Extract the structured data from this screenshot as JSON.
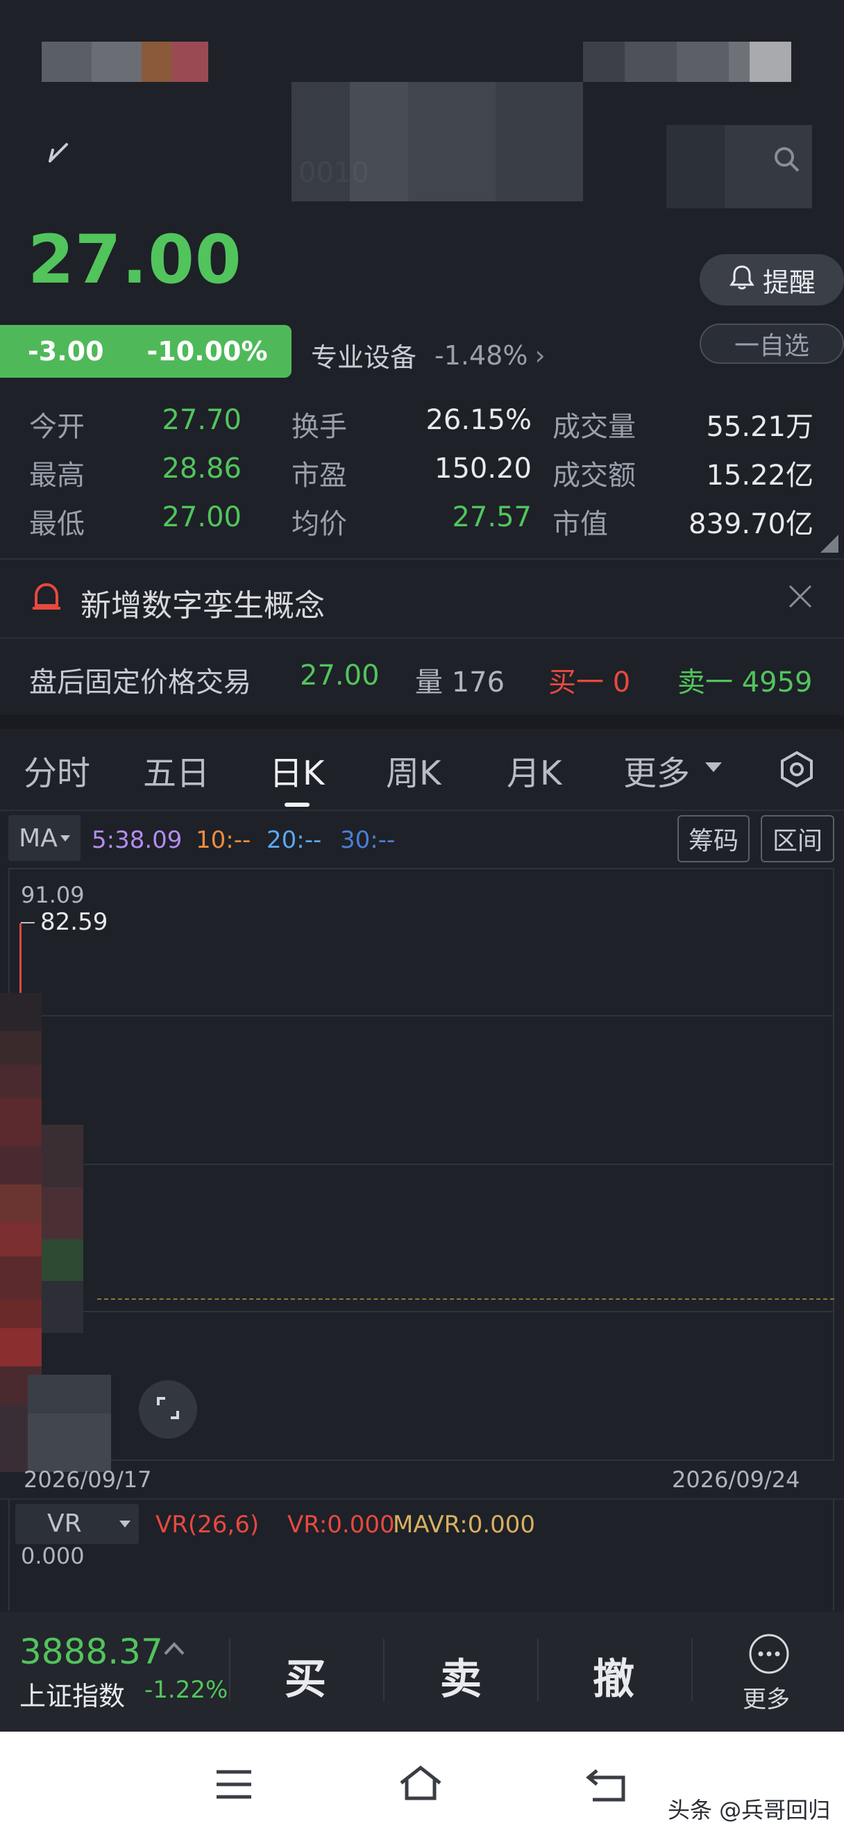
{
  "header": {
    "price": "27.00",
    "change": "-3.00",
    "change_pct": "-10.00%",
    "sector": "专业设备",
    "sector_pct": "-1.48%",
    "sector_arrow": "›",
    "remind_label": "提醒",
    "watch_label": "一自选",
    "code_partial": "0010"
  },
  "stats": [
    {
      "label": "今开",
      "value": "27.70",
      "color": "green"
    },
    {
      "label": "换手",
      "value": "26.15%",
      "color": "white"
    },
    {
      "label": "成交量",
      "value": "55.21万",
      "color": "white"
    },
    {
      "label": "最高",
      "value": "28.86",
      "color": "green"
    },
    {
      "label": "市盈",
      "value": "150.20",
      "color": "white"
    },
    {
      "label": "成交额",
      "value": "15.22亿",
      "color": "white"
    },
    {
      "label": "最低",
      "value": "27.00",
      "color": "green"
    },
    {
      "label": "均价",
      "value": "27.57",
      "color": "green"
    },
    {
      "label": "市值",
      "value": "839.70亿",
      "color": "white"
    }
  ],
  "notice": {
    "text": "新增数字孪生概念"
  },
  "after_hours": {
    "label": "盘后固定价格交易",
    "price": "27.00",
    "vol_label": "量 176",
    "buy_label": "买一 0",
    "sell_label": "卖一 4959"
  },
  "tabs": [
    "分时",
    "五日",
    "日K",
    "周K",
    "月K",
    "更多"
  ],
  "ma": {
    "selector": "MA",
    "ma5": "5:38.09",
    "ma10": "10:--",
    "ma20": "20:--",
    "ma30": "30:--",
    "btn_chips": "筹码",
    "btn_range": "区间"
  },
  "chart": {
    "high_label": "91.09",
    "peak_label": "82.59",
    "date_start": "2026/09/17",
    "date_end": "2026/09/24"
  },
  "vr": {
    "selector": "VR",
    "params": "VR(26,6)",
    "vr_value": "VR:0.000",
    "mavr_value": "MAVR:0.000",
    "axis_value": "0.000"
  },
  "bottom": {
    "index_value": "3888.37",
    "index_name": "上证指数",
    "index_pct": "-1.22%",
    "buy": "买",
    "sell": "卖",
    "cancel": "撤",
    "more": "更多"
  },
  "watermark": "头条 @兵哥回归",
  "colors": {
    "green": "#52c45c",
    "red": "#e8493f",
    "ma5": "#b48cf0",
    "ma10": "#f08c3c",
    "ma20": "#5aa8f0",
    "ma30": "#4a7fd8",
    "mavr": "#d9b060"
  }
}
